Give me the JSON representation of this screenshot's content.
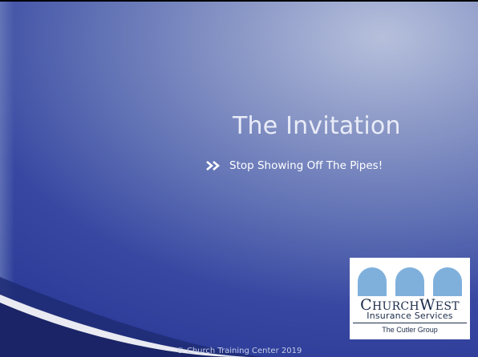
{
  "slide": {
    "title": "The Invitation",
    "bullets": [
      {
        "icon": "double-chevron-right-icon",
        "text": "Stop Showing Off The Pipes!"
      }
    ],
    "footer": "© Church Training Center 2019"
  },
  "logo": {
    "name_first_initial": "C",
    "name_first_rest": "HURCH",
    "name_second_initial": "W",
    "name_second_rest": "EST",
    "subtitle": "Insurance Services",
    "group": "The Cutler Group",
    "arch_color": "#7fb0dc"
  },
  "colors": {
    "background_dark": "#2d3d99",
    "background_light": "#b6c0dc",
    "text": "#ffffff",
    "bullet_icon": "#ffffff"
  }
}
